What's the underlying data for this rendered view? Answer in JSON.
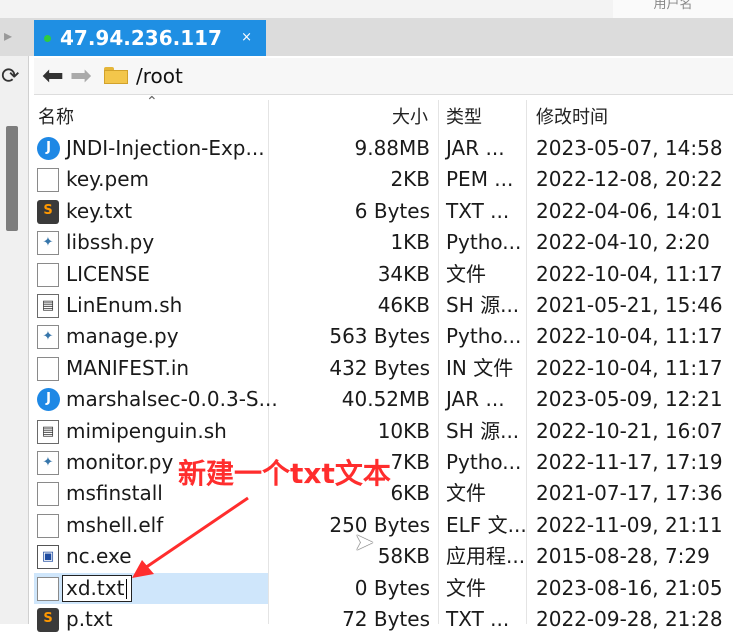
{
  "window": {
    "top_corner_text": "用户名",
    "tab": {
      "title": "47.94.236.117",
      "close_label": "×",
      "status_color": "#2ecc40",
      "accent": "#1f8fe3"
    }
  },
  "address_bar": {
    "path": "/root",
    "back_icon": "arrow-left-icon",
    "forward_icon": "arrow-right-icon",
    "folder_icon": "folder-icon"
  },
  "columns": {
    "name": "名称",
    "size": "大小",
    "type": "类型",
    "modified": "修改时间"
  },
  "files": [
    {
      "icon": "jar-icon",
      "name": "JNDI-Injection-Exp...",
      "size": "9.88MB",
      "type": "JAR ...",
      "modified": "2023-05-07, 14:58"
    },
    {
      "icon": "doc-icon",
      "name": "key.pem",
      "size": "2KB",
      "type": "PEM ...",
      "modified": "2022-12-08, 20:22"
    },
    {
      "icon": "sublime-icon",
      "name": "key.txt",
      "size": "6 Bytes",
      "type": "TXT ...",
      "modified": "2022-04-06, 14:01"
    },
    {
      "icon": "python-icon",
      "name": "libssh.py",
      "size": "1KB",
      "type": "Pytho...",
      "modified": "2022-04-10, 2:20"
    },
    {
      "icon": "doc-icon",
      "name": "LICENSE",
      "size": "34KB",
      "type": "文件",
      "modified": "2022-10-04, 11:17"
    },
    {
      "icon": "shell-icon",
      "name": "LinEnum.sh",
      "size": "46KB",
      "type": "SH 源...",
      "modified": "2021-05-21, 15:46"
    },
    {
      "icon": "python-icon",
      "name": "manage.py",
      "size": "563 Bytes",
      "type": "Pytho...",
      "modified": "2022-10-04, 11:17"
    },
    {
      "icon": "doc-icon",
      "name": "MANIFEST.in",
      "size": "432 Bytes",
      "type": "IN 文件",
      "modified": "2022-10-04, 11:17"
    },
    {
      "icon": "jar-icon",
      "name": "marshalsec-0.0.3-S...",
      "size": "40.52MB",
      "type": "JAR ...",
      "modified": "2023-05-09, 12:21"
    },
    {
      "icon": "shell-icon",
      "name": "mimipenguin.sh",
      "size": "10KB",
      "type": "SH 源...",
      "modified": "2022-10-21, 16:07"
    },
    {
      "icon": "python-icon",
      "name": "monitor.py",
      "size": "7KB",
      "type": "Pytho...",
      "modified": "2022-11-17, 17:19"
    },
    {
      "icon": "doc-icon",
      "name": "msfinstall",
      "size": "6KB",
      "type": "文件",
      "modified": "2021-07-17, 17:36"
    },
    {
      "icon": "doc-icon",
      "name": "mshell.elf",
      "size": "250 Bytes",
      "type": "ELF 文...",
      "modified": "2022-11-09, 21:11"
    },
    {
      "icon": "exe-icon",
      "name": "nc.exe",
      "size": "58KB",
      "type": "应用程...",
      "modified": "2015-08-28, 7:29"
    },
    {
      "icon": "doc-icon",
      "name": "xd.txt",
      "size": "0 Bytes",
      "type": "文件",
      "modified": "2023-08-16, 21:05",
      "selected": true,
      "renaming": true
    },
    {
      "icon": "sublime-icon",
      "name": "p.txt",
      "size": "72 Bytes",
      "type": "TXT ...",
      "modified": "2022-09-28, 21:28"
    }
  ],
  "annotation": {
    "text": "新建一个txt文本",
    "color": "#ff2d2d"
  }
}
